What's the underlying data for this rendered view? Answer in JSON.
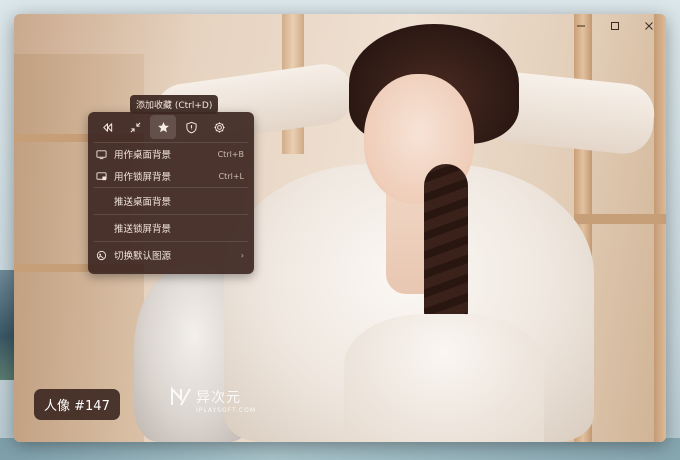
{
  "window": {
    "controls": [
      {
        "name": "minimize",
        "icon": "minimize-icon"
      },
      {
        "name": "maximize",
        "icon": "maximize-icon"
      },
      {
        "name": "close",
        "icon": "close-icon"
      }
    ]
  },
  "tooltip": {
    "text": "添加收藏 (Ctrl+D)"
  },
  "menu": {
    "toolbar_icons": [
      "rewind-icon",
      "shrink-icon",
      "star-icon",
      "shield-icon",
      "gear-icon"
    ],
    "active_toolbar_icon": "star-icon",
    "items": [
      {
        "icon": "monitor-icon",
        "label": "用作桌面背景",
        "shortcut": "Ctrl+B"
      },
      {
        "icon": "lock-screen-icon",
        "label": "用作锁屏背景",
        "shortcut": "Ctrl+L"
      },
      {
        "icon": "",
        "label": "推送桌面背景",
        "shortcut": ""
      },
      {
        "icon": "",
        "label": "推送锁屏背景",
        "shortcut": ""
      },
      {
        "icon": "source-icon",
        "label": "切换默认图源",
        "shortcut": "",
        "submenu": true
      }
    ]
  },
  "badge": {
    "text": "人像 #147"
  },
  "watermark": {
    "text": "异次元",
    "sub": "IPLAYSOFT.COM"
  },
  "colors": {
    "menu_bg": "#3e2822",
    "badge_bg": "#37221c",
    "text_light": "#f1e5dd"
  }
}
